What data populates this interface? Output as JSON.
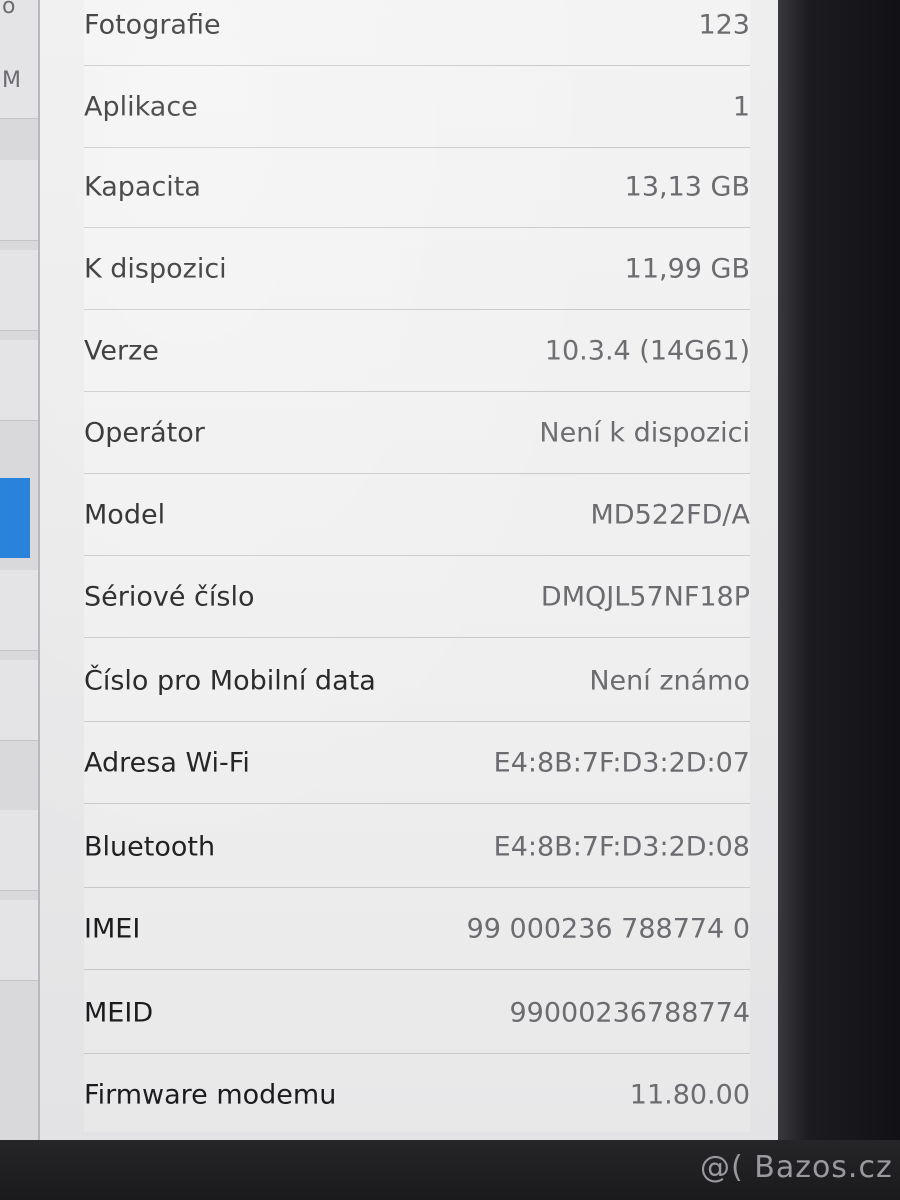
{
  "sidebar": {
    "fragments": [
      "o",
      "M"
    ]
  },
  "about": {
    "rows": [
      {
        "label": "Fotografie",
        "value": "123"
      },
      {
        "label": "Aplikace",
        "value": "1"
      },
      {
        "label": "Kapacita",
        "value": "13,13 GB"
      },
      {
        "label": "K dispozici",
        "value": "11,99 GB"
      },
      {
        "label": "Verze",
        "value": "10.3.4 (14G61)"
      },
      {
        "label": "Operátor",
        "value": "Není k dispozici"
      },
      {
        "label": "Model",
        "value": "MD522FD/A"
      },
      {
        "label": "Sériové číslo",
        "value": "DMQJL57NF18P"
      },
      {
        "label": "Číslo pro Mobilní data",
        "value": "Není známo"
      },
      {
        "label": "Adresa Wi-Fi",
        "value": "E4:8B:7F:D3:2D:07"
      },
      {
        "label": "Bluetooth",
        "value": "E4:8B:7F:D3:2D:08"
      },
      {
        "label": "IMEI",
        "value": "99 000236 788774 0"
      },
      {
        "label": "MEID",
        "value": "99000236788774"
      },
      {
        "label": "Firmware modemu",
        "value": "11.80.00"
      }
    ]
  },
  "watermark": "@( Bazos.cz"
}
